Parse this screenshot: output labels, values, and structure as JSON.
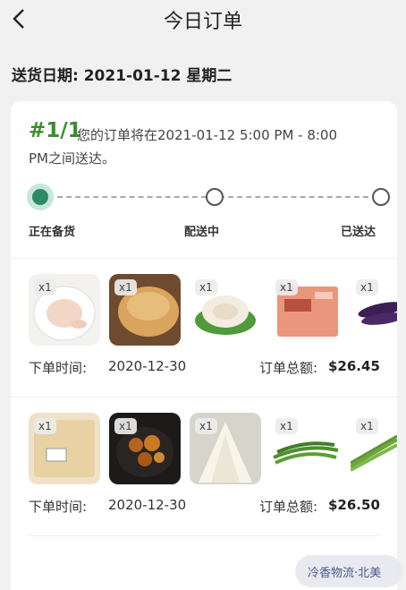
{
  "header": {
    "title": "今日订单"
  },
  "delivery": {
    "label": "送货日期: 2021-01-12 星期二"
  },
  "order": {
    "id": "#1/1",
    "note_line1": "您的订单将在2021-01-12 5:00 PM - 8:00",
    "note_line2": "PM之间送达。",
    "steps": [
      "正在备货",
      "配送中",
      "已送达"
    ],
    "progress_step": 1
  },
  "colors": {
    "accent": "#3a8e2c",
    "step_active": "#2c8a68"
  },
  "groups": [
    {
      "items": [
        {
          "icon": "chicken-image",
          "qty": "x1"
        },
        {
          "icon": "bread-image",
          "qty": "x1"
        },
        {
          "icon": "sliced-meat-image",
          "qty": "x1"
        },
        {
          "icon": "shrimp-pack-image",
          "qty": "x1"
        },
        {
          "icon": "eggplant-image",
          "qty": "x1"
        }
      ],
      "order_time_label": "下单时间:",
      "order_time": "2020-12-30",
      "total_label": "订单总额:",
      "total": "$26.45"
    },
    {
      "items": [
        {
          "icon": "tofu-pack-image",
          "qty": "x1"
        },
        {
          "icon": "fried-chicken-image",
          "qty": "x1"
        },
        {
          "icon": "enoki-image",
          "qty": "x1"
        },
        {
          "icon": "green-beans-image",
          "qty": "x1"
        },
        {
          "icon": "scallion-image",
          "qty": "x1"
        }
      ],
      "order_time_label": "下单时间:",
      "order_time": "2020-12-30",
      "total_label": "订单总额:",
      "total": "$26.50"
    }
  ],
  "watermark": {
    "text": "冷香物流·北美"
  }
}
